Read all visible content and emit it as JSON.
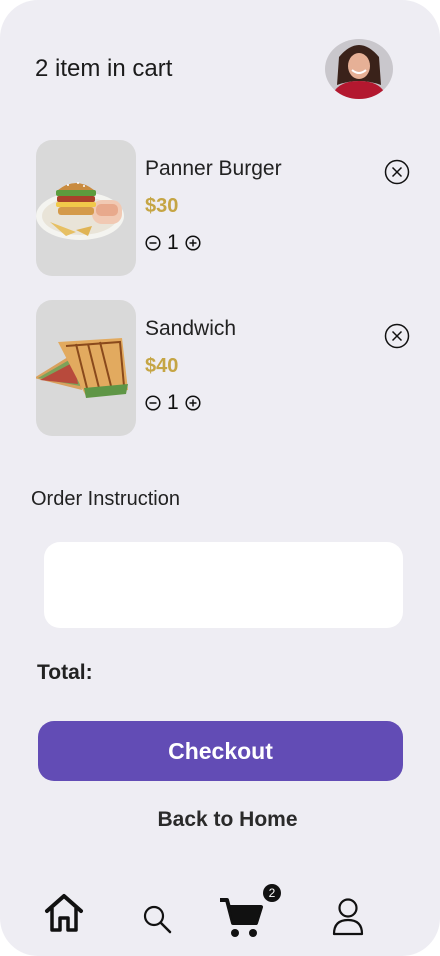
{
  "header": {
    "title": "2 item in cart",
    "avatar_icon": "user-photo"
  },
  "cart": {
    "items": [
      {
        "name": "Panner Burger",
        "price": "$30",
        "quantity": "1",
        "image_icon": "burger-image"
      },
      {
        "name": "Sandwich",
        "price": "$40",
        "quantity": "1",
        "image_icon": "sandwich-image"
      }
    ]
  },
  "order_instruction": {
    "label": "Order Instruction",
    "value": "",
    "placeholder": ""
  },
  "summary": {
    "total_label": "Total:"
  },
  "actions": {
    "checkout_label": "Checkout",
    "back_home_label": "Back to Home"
  },
  "bottom_nav": {
    "items": [
      {
        "icon": "home-icon",
        "active": true
      },
      {
        "icon": "search-icon",
        "active": false
      },
      {
        "icon": "cart-icon",
        "active": false
      },
      {
        "icon": "profile-icon",
        "active": false
      }
    ],
    "cart_badge": "2"
  },
  "colors": {
    "background": "#eeedf3",
    "accent": "#624cb5",
    "price": "#c5a544"
  }
}
